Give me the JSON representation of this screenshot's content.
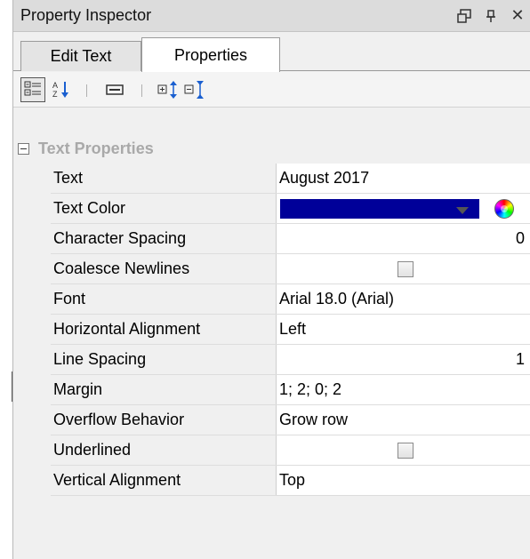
{
  "panel": {
    "title": "Property Inspector",
    "icons": {
      "float": "window-restore-icon",
      "pin": "pin-icon",
      "close": "close-icon"
    },
    "close_glyph": "✕"
  },
  "tabs": [
    {
      "label": "Edit Text",
      "active": false
    },
    {
      "label": "Properties",
      "active": true
    }
  ],
  "toolbar": {
    "icons": [
      "categorized-icon",
      "sort-alpha-icon",
      "property-pages-icon",
      "expand-all-icon",
      "collapse-all-icon"
    ]
  },
  "group": {
    "title": "Text Properties",
    "collapsed": false
  },
  "properties": [
    {
      "name": "Text",
      "value": "August 2017"
    },
    {
      "name": "Text Color",
      "value": "",
      "color": "#000099"
    },
    {
      "name": "Character Spacing",
      "value": "0"
    },
    {
      "name": "Coalesce Newlines",
      "checked": false
    },
    {
      "name": "Font",
      "value": "Arial 18.0 (Arial)"
    },
    {
      "name": "Horizontal Alignment",
      "value": "Left"
    },
    {
      "name": "Line Spacing",
      "value": "1"
    },
    {
      "name": "Margin",
      "value": "1; 2; 0; 2"
    },
    {
      "name": "Overflow Behavior",
      "value": "Grow row"
    },
    {
      "name": "Underlined",
      "checked": false
    },
    {
      "name": "Vertical Alignment",
      "value": "Top"
    }
  ],
  "colors": {
    "accent_swatch": "#000099",
    "group_title": "#a9a9a9"
  }
}
